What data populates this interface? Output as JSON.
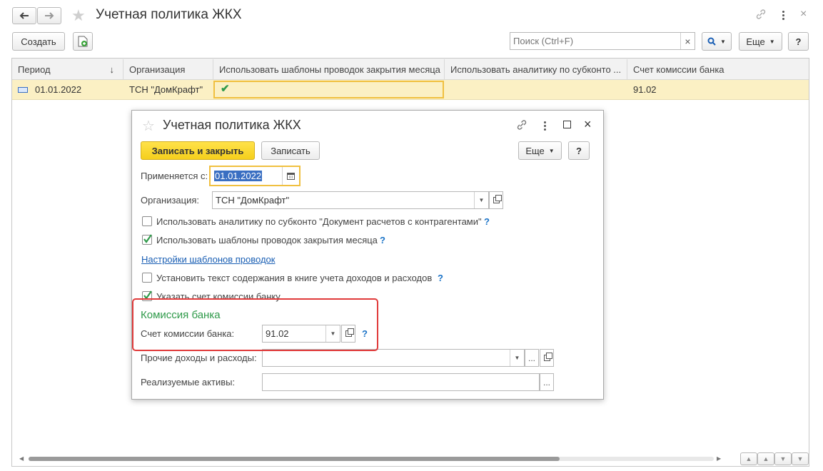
{
  "main_window": {
    "title": "Учетная политика ЖКХ",
    "back_icon": "arrow-left-icon",
    "forward_icon": "arrow-right-icon",
    "create_label": "Создать",
    "search_placeholder": "Поиск (Ctrl+F)",
    "clear_search": "×",
    "more_label": "Еще",
    "help_label": "?"
  },
  "table": {
    "columns": [
      "Период",
      "Организация",
      "Использовать шаблоны проводок закрытия месяца",
      "Использовать аналитику по субконто ...",
      "Счет комиссии банка"
    ],
    "sort_indicator": "↓",
    "rows": [
      {
        "period": "01.01.2022",
        "organization": "ТСН \"ДомКрафт\"",
        "use_templates": "✔",
        "use_analytics": "",
        "bank_account": "91.02"
      }
    ]
  },
  "dialog": {
    "title": "Учетная политика ЖКХ",
    "save_close_label": "Записать и закрыть",
    "save_label": "Записать",
    "more_label": "Еще",
    "help_label": "?",
    "applies_from_label": "Применяется с:",
    "applies_from_value": "01.01.2022",
    "organization_label": "Организация:",
    "organization_value": "ТСН \"ДомКрафт\"",
    "cb_analytics_label": "Использовать аналитику по субконто \"Документ расчетов с контрагентами\"",
    "cb_analytics_checked": false,
    "cb_templates_label": "Использовать шаблоны проводок закрытия месяца",
    "cb_templates_checked": true,
    "templates_link": "Настройки шаблонов проводок",
    "cb_text_label": "Установить текст содержания в книге учета доходов и расходов",
    "cb_text_checked": false,
    "cb_bank_label": "Указать счет комиссии банку",
    "cb_bank_checked": true,
    "bank_section_title": "Комиссия банка",
    "bank_account_label": "Счет комиссии банка:",
    "bank_account_value": "91.02",
    "other_income_label": "Прочие доходы и расходы:",
    "other_income_value": "",
    "assets_label": "Реализуемые активы:",
    "assets_value": "",
    "help_mark": "?",
    "ellipsis": "..."
  },
  "colors": {
    "selected_row": "#fbf0c4",
    "accent_yellow": "#f5d628",
    "highlight_red": "#e03a3a",
    "section_green": "#2f9a4a",
    "link_blue": "#1a5fb4"
  }
}
